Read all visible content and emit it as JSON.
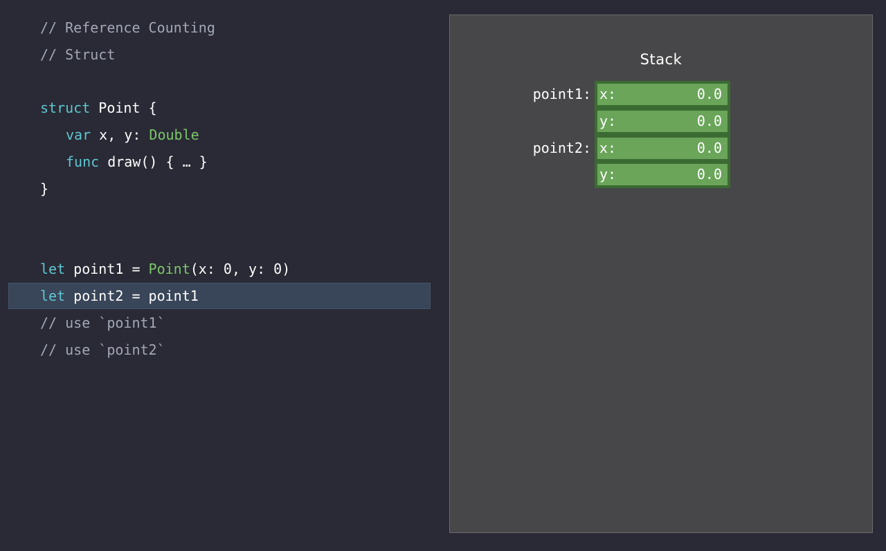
{
  "code": {
    "lines": [
      {
        "tokens": [
          {
            "t": "// Reference Counting",
            "c": "comment"
          }
        ]
      },
      {
        "tokens": [
          {
            "t": "// Struct",
            "c": "comment"
          }
        ]
      },
      {
        "tokens": []
      },
      {
        "tokens": [
          {
            "t": "struct",
            "c": "keyword"
          },
          {
            "t": " Point {",
            "c": "plain"
          }
        ]
      },
      {
        "tokens": [
          {
            "t": "var",
            "c": "keyword"
          },
          {
            "t": " x, y: ",
            "c": "plain"
          },
          {
            "t": "Double",
            "c": "type"
          }
        ],
        "indent": true
      },
      {
        "tokens": [
          {
            "t": "func",
            "c": "keyword"
          },
          {
            "t": " draw() { … }",
            "c": "plain"
          }
        ],
        "indent": true
      },
      {
        "tokens": [
          {
            "t": "}",
            "c": "plain"
          }
        ]
      },
      {
        "tokens": []
      },
      {
        "tokens": []
      },
      {
        "tokens": [
          {
            "t": "let",
            "c": "keyword"
          },
          {
            "t": " point1 = ",
            "c": "plain"
          },
          {
            "t": "Point",
            "c": "type"
          },
          {
            "t": "(x: 0, y: 0)",
            "c": "plain"
          }
        ]
      },
      {
        "tokens": [
          {
            "t": "let",
            "c": "keyword"
          },
          {
            "t": " point2 = point1",
            "c": "plain"
          }
        ],
        "highlight": true
      },
      {
        "tokens": [
          {
            "t": "// use `point1`",
            "c": "comment"
          }
        ]
      },
      {
        "tokens": [
          {
            "t": "// use `point2`",
            "c": "comment"
          }
        ]
      }
    ]
  },
  "memory": {
    "title": "Stack",
    "variables": [
      {
        "label": "point1:",
        "fields": [
          {
            "key": "x:",
            "value": "0.0"
          },
          {
            "key": "y:",
            "value": "0.0"
          }
        ]
      },
      {
        "label": "point2:",
        "fields": [
          {
            "key": "x:",
            "value": "0.0"
          },
          {
            "key": "y:",
            "value": "0.0"
          }
        ]
      }
    ]
  },
  "colors": {
    "background": "#292a35",
    "comment": "#a3a7b7",
    "keyword": "#5fc7d2",
    "type": "#7dc66a",
    "highlight": "#394558",
    "panel": "#474749",
    "cell": "#6aa55a",
    "cell_border": "#3b6b33"
  }
}
